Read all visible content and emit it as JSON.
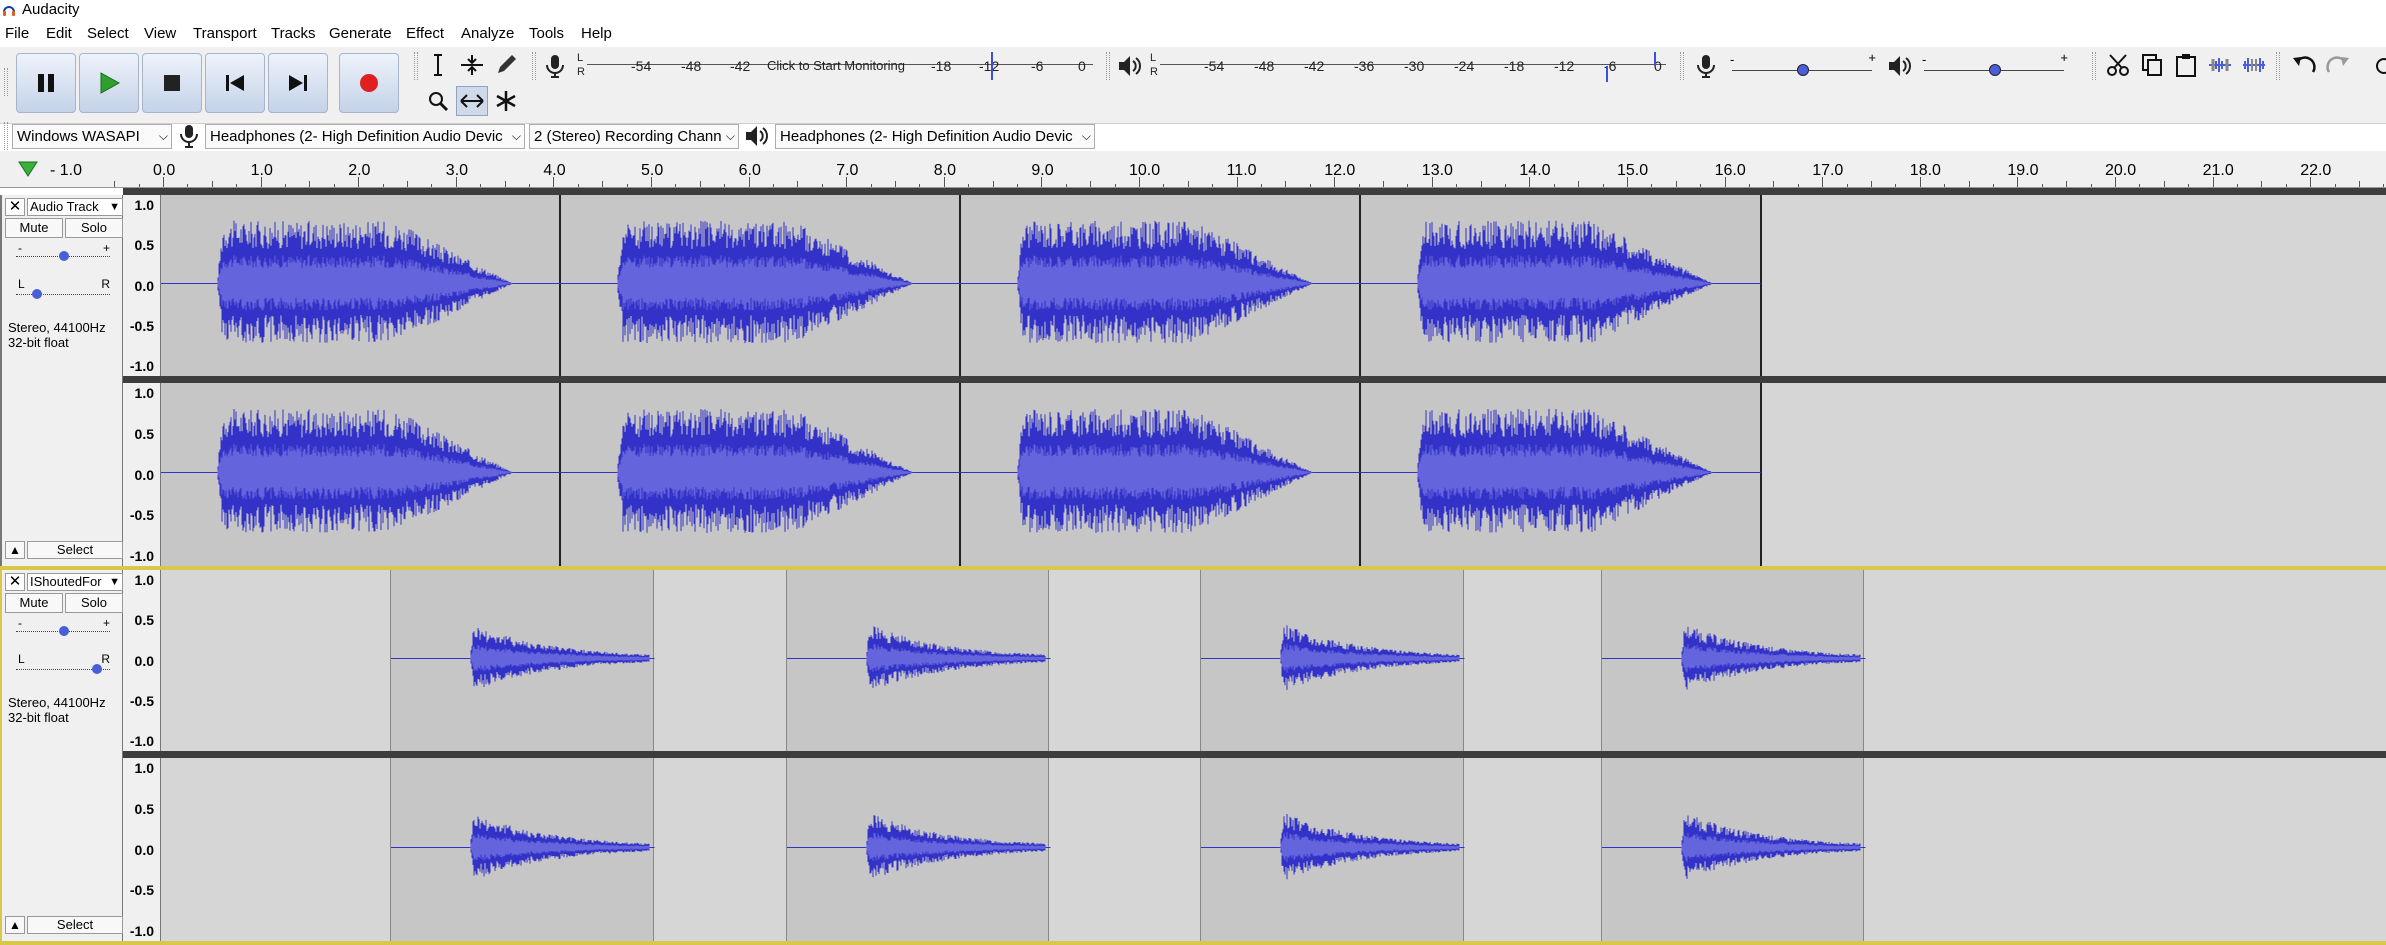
{
  "window": {
    "title": "Audacity"
  },
  "menu": [
    "File",
    "Edit",
    "Select",
    "View",
    "Transport",
    "Tracks",
    "Generate",
    "Effect",
    "Analyze",
    "Tools",
    "Help"
  ],
  "transport": {
    "buttons": [
      "pause",
      "play",
      "stop",
      "skip-to-start",
      "skip-to-end",
      "record"
    ]
  },
  "record_meter": {
    "lr": "L\nR",
    "ticks": [
      "-54",
      "-48",
      "-42",
      "Click to Start Monitoring",
      "-18",
      "-12",
      "-6",
      "0"
    ]
  },
  "play_meter": {
    "lr": "L\nR",
    "ticks": [
      "-54",
      "-48",
      "-42",
      "-36",
      "-30",
      "-24",
      "-18",
      "-12",
      "-6",
      "0"
    ]
  },
  "mixer": {
    "minus": "-",
    "plus": "+"
  },
  "device_toolbar": {
    "host": "Windows WASAPI",
    "recording_device": "Headphones (2- High Definition Audio Devic",
    "channels": "2 (Stereo) Recording Chann",
    "playback_device": "Headphones (2- High Definition Audio Devic"
  },
  "ruler": {
    "labels": [
      "- 1.0",
      "0.0",
      "1.0",
      "2.0",
      "3.0",
      "4.0",
      "5.0",
      "6.0",
      "7.0",
      "8.0",
      "9.0",
      "10.0",
      "11.0",
      "12.0",
      "13.0",
      "14.0",
      "15.0",
      "16.0",
      "17.0",
      "18.0",
      "19.0",
      "20.0",
      "21.0",
      "22.0"
    ]
  },
  "amp_labels": [
    "1.0",
    "0.5",
    "0.0",
    "-0.5",
    "-1.0"
  ],
  "tracks": [
    {
      "name": "Audio Track",
      "mute": "Mute",
      "solo": "Solo",
      "gain_minus": "-",
      "gain_plus": "+",
      "pan_l": "L",
      "pan_r": "R",
      "info_line1": "Stereo, 44100Hz",
      "info_line2": "32-bit float",
      "select": "Select"
    },
    {
      "name": "IShoutedFor",
      "mute": "Mute",
      "solo": "Solo",
      "gain_minus": "-",
      "gain_plus": "+",
      "pan_l": "L",
      "pan_r": "R",
      "info_line1": "Stereo, 44100Hz",
      "info_line2": "32-bit float",
      "select": "Select"
    }
  ],
  "colors": {
    "waveform": "#3232c8",
    "waveform_rms": "#6464dc",
    "clip_bg": "#c6c6c6",
    "track_bg": "#d6d6d6",
    "toolbar_bg": "#f0f0f0"
  }
}
